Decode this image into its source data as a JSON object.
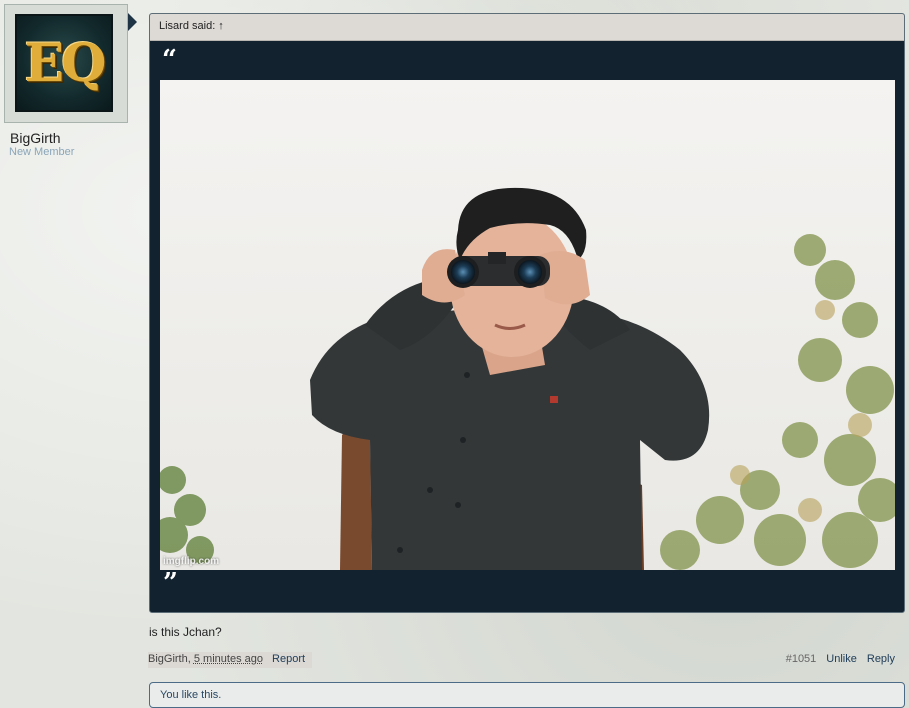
{
  "user": {
    "avatar_letters": "EQ",
    "name": "BigGirth",
    "title": "New Member"
  },
  "quote": {
    "header": "Lisard said: ↑",
    "open_mark": "“",
    "close_mark": "”",
    "image_watermark": "imgflip.com"
  },
  "post": {
    "message": "is this Jchan?",
    "author": "BigGirth",
    "time": "5 minutes ago",
    "report": "Report",
    "number": "#1051",
    "unlike": "Unlike",
    "reply": "Reply",
    "likes_text": "You like this."
  },
  "colors": {
    "quote_bg": "#12222f",
    "quote_header_bg": "#ddd9d5",
    "link": "#1e3b57",
    "title_color": "#8aa5b8"
  }
}
